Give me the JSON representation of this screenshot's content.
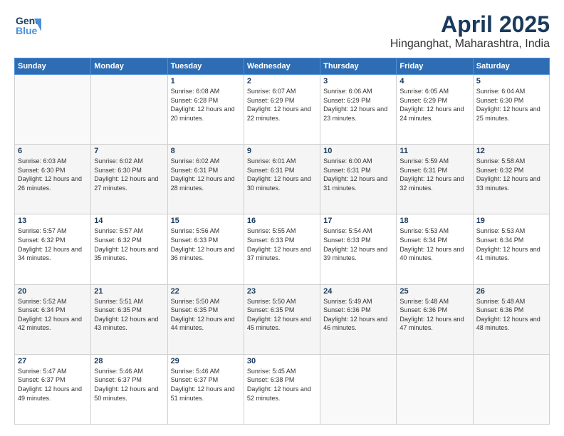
{
  "header": {
    "logo_line1": "General",
    "logo_line2": "Blue",
    "title": "April 2025",
    "subtitle": "Hinganghat, Maharashtra, India"
  },
  "weekdays": [
    "Sunday",
    "Monday",
    "Tuesday",
    "Wednesday",
    "Thursday",
    "Friday",
    "Saturday"
  ],
  "weeks": [
    [
      {
        "day": "",
        "sunrise": "",
        "sunset": "",
        "daylight": ""
      },
      {
        "day": "",
        "sunrise": "",
        "sunset": "",
        "daylight": ""
      },
      {
        "day": "1",
        "sunrise": "Sunrise: 6:08 AM",
        "sunset": "Sunset: 6:28 PM",
        "daylight": "Daylight: 12 hours and 20 minutes."
      },
      {
        "day": "2",
        "sunrise": "Sunrise: 6:07 AM",
        "sunset": "Sunset: 6:29 PM",
        "daylight": "Daylight: 12 hours and 22 minutes."
      },
      {
        "day": "3",
        "sunrise": "Sunrise: 6:06 AM",
        "sunset": "Sunset: 6:29 PM",
        "daylight": "Daylight: 12 hours and 23 minutes."
      },
      {
        "day": "4",
        "sunrise": "Sunrise: 6:05 AM",
        "sunset": "Sunset: 6:29 PM",
        "daylight": "Daylight: 12 hours and 24 minutes."
      },
      {
        "day": "5",
        "sunrise": "Sunrise: 6:04 AM",
        "sunset": "Sunset: 6:30 PM",
        "daylight": "Daylight: 12 hours and 25 minutes."
      }
    ],
    [
      {
        "day": "6",
        "sunrise": "Sunrise: 6:03 AM",
        "sunset": "Sunset: 6:30 PM",
        "daylight": "Daylight: 12 hours and 26 minutes."
      },
      {
        "day": "7",
        "sunrise": "Sunrise: 6:02 AM",
        "sunset": "Sunset: 6:30 PM",
        "daylight": "Daylight: 12 hours and 27 minutes."
      },
      {
        "day": "8",
        "sunrise": "Sunrise: 6:02 AM",
        "sunset": "Sunset: 6:31 PM",
        "daylight": "Daylight: 12 hours and 28 minutes."
      },
      {
        "day": "9",
        "sunrise": "Sunrise: 6:01 AM",
        "sunset": "Sunset: 6:31 PM",
        "daylight": "Daylight: 12 hours and 30 minutes."
      },
      {
        "day": "10",
        "sunrise": "Sunrise: 6:00 AM",
        "sunset": "Sunset: 6:31 PM",
        "daylight": "Daylight: 12 hours and 31 minutes."
      },
      {
        "day": "11",
        "sunrise": "Sunrise: 5:59 AM",
        "sunset": "Sunset: 6:31 PM",
        "daylight": "Daylight: 12 hours and 32 minutes."
      },
      {
        "day": "12",
        "sunrise": "Sunrise: 5:58 AM",
        "sunset": "Sunset: 6:32 PM",
        "daylight": "Daylight: 12 hours and 33 minutes."
      }
    ],
    [
      {
        "day": "13",
        "sunrise": "Sunrise: 5:57 AM",
        "sunset": "Sunset: 6:32 PM",
        "daylight": "Daylight: 12 hours and 34 minutes."
      },
      {
        "day": "14",
        "sunrise": "Sunrise: 5:57 AM",
        "sunset": "Sunset: 6:32 PM",
        "daylight": "Daylight: 12 hours and 35 minutes."
      },
      {
        "day": "15",
        "sunrise": "Sunrise: 5:56 AM",
        "sunset": "Sunset: 6:33 PM",
        "daylight": "Daylight: 12 hours and 36 minutes."
      },
      {
        "day": "16",
        "sunrise": "Sunrise: 5:55 AM",
        "sunset": "Sunset: 6:33 PM",
        "daylight": "Daylight: 12 hours and 37 minutes."
      },
      {
        "day": "17",
        "sunrise": "Sunrise: 5:54 AM",
        "sunset": "Sunset: 6:33 PM",
        "daylight": "Daylight: 12 hours and 39 minutes."
      },
      {
        "day": "18",
        "sunrise": "Sunrise: 5:53 AM",
        "sunset": "Sunset: 6:34 PM",
        "daylight": "Daylight: 12 hours and 40 minutes."
      },
      {
        "day": "19",
        "sunrise": "Sunrise: 5:53 AM",
        "sunset": "Sunset: 6:34 PM",
        "daylight": "Daylight: 12 hours and 41 minutes."
      }
    ],
    [
      {
        "day": "20",
        "sunrise": "Sunrise: 5:52 AM",
        "sunset": "Sunset: 6:34 PM",
        "daylight": "Daylight: 12 hours and 42 minutes."
      },
      {
        "day": "21",
        "sunrise": "Sunrise: 5:51 AM",
        "sunset": "Sunset: 6:35 PM",
        "daylight": "Daylight: 12 hours and 43 minutes."
      },
      {
        "day": "22",
        "sunrise": "Sunrise: 5:50 AM",
        "sunset": "Sunset: 6:35 PM",
        "daylight": "Daylight: 12 hours and 44 minutes."
      },
      {
        "day": "23",
        "sunrise": "Sunrise: 5:50 AM",
        "sunset": "Sunset: 6:35 PM",
        "daylight": "Daylight: 12 hours and 45 minutes."
      },
      {
        "day": "24",
        "sunrise": "Sunrise: 5:49 AM",
        "sunset": "Sunset: 6:36 PM",
        "daylight": "Daylight: 12 hours and 46 minutes."
      },
      {
        "day": "25",
        "sunrise": "Sunrise: 5:48 AM",
        "sunset": "Sunset: 6:36 PM",
        "daylight": "Daylight: 12 hours and 47 minutes."
      },
      {
        "day": "26",
        "sunrise": "Sunrise: 5:48 AM",
        "sunset": "Sunset: 6:36 PM",
        "daylight": "Daylight: 12 hours and 48 minutes."
      }
    ],
    [
      {
        "day": "27",
        "sunrise": "Sunrise: 5:47 AM",
        "sunset": "Sunset: 6:37 PM",
        "daylight": "Daylight: 12 hours and 49 minutes."
      },
      {
        "day": "28",
        "sunrise": "Sunrise: 5:46 AM",
        "sunset": "Sunset: 6:37 PM",
        "daylight": "Daylight: 12 hours and 50 minutes."
      },
      {
        "day": "29",
        "sunrise": "Sunrise: 5:46 AM",
        "sunset": "Sunset: 6:37 PM",
        "daylight": "Daylight: 12 hours and 51 minutes."
      },
      {
        "day": "30",
        "sunrise": "Sunrise: 5:45 AM",
        "sunset": "Sunset: 6:38 PM",
        "daylight": "Daylight: 12 hours and 52 minutes."
      },
      {
        "day": "",
        "sunrise": "",
        "sunset": "",
        "daylight": ""
      },
      {
        "day": "",
        "sunrise": "",
        "sunset": "",
        "daylight": ""
      },
      {
        "day": "",
        "sunrise": "",
        "sunset": "",
        "daylight": ""
      }
    ]
  ]
}
